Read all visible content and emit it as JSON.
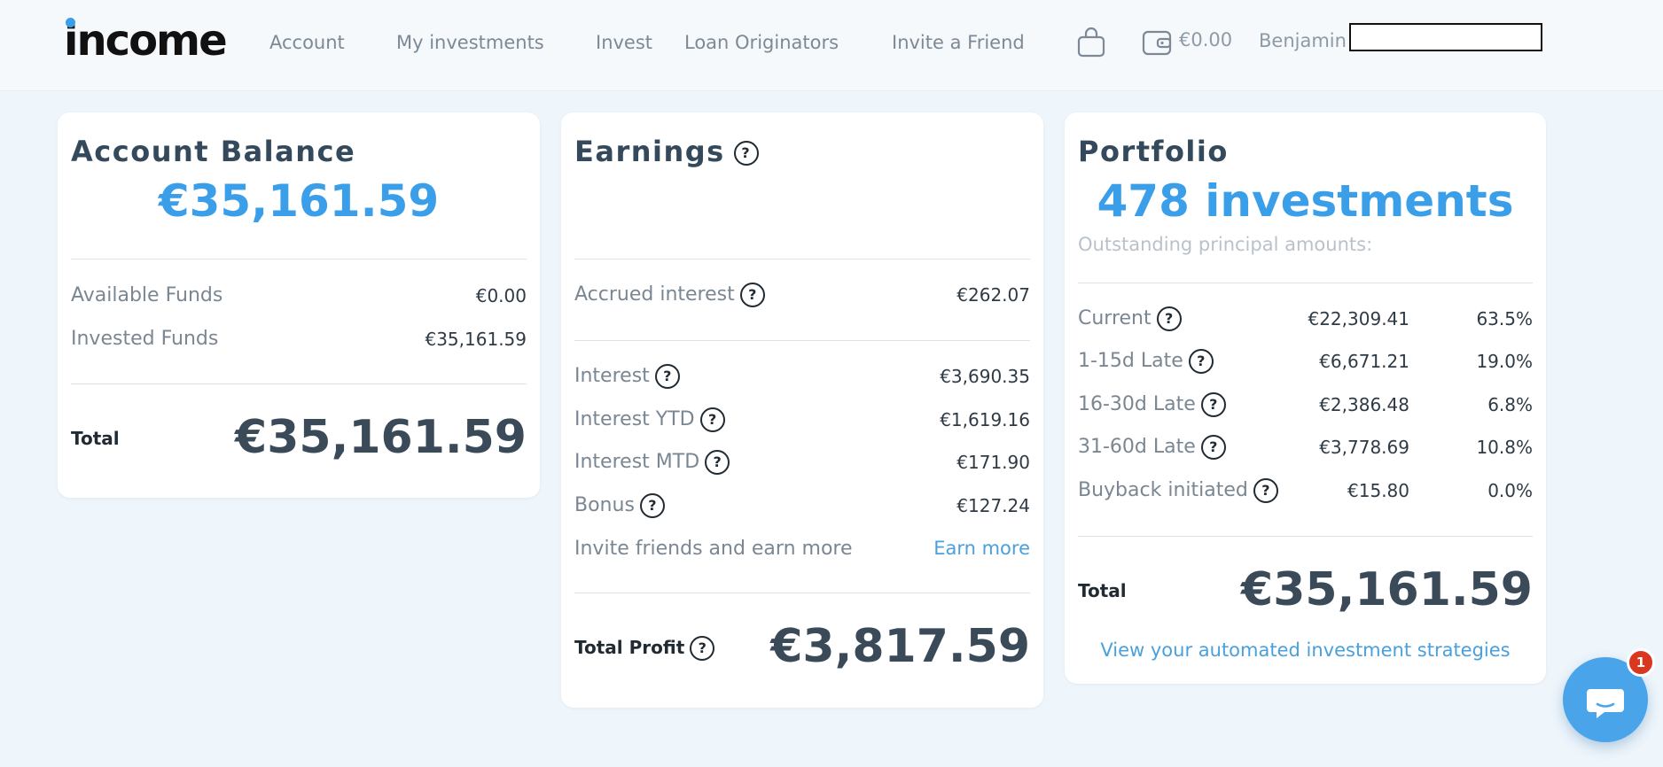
{
  "header": {
    "logo_text": "income",
    "nav": [
      "Account",
      "My investments",
      "Invest",
      "Loan Originators",
      "Invite a Friend"
    ],
    "wallet_amount": "€0.00",
    "user_name": "Benjamin"
  },
  "account_balance": {
    "title": "Account Balance",
    "balance": "€35,161.59",
    "rows": [
      {
        "label": "Available Funds",
        "value": "€0.00"
      },
      {
        "label": "Invested Funds",
        "value": "€35,161.59"
      }
    ],
    "total_label": "Total",
    "total_value": "€35,161.59"
  },
  "earnings": {
    "title": "Earnings",
    "accrued": {
      "label": "Accrued interest",
      "value": "€262.07"
    },
    "rows": [
      {
        "label": "Interest",
        "value": "€3,690.35"
      },
      {
        "label": "Interest YTD",
        "value": "€1,619.16"
      },
      {
        "label": "Interest MTD",
        "value": "€171.90"
      },
      {
        "label": "Bonus",
        "value": "€127.24"
      }
    ],
    "invite_label": "Invite friends and earn more",
    "invite_link": "Earn more",
    "total_label": "Total Profit",
    "total_value": "€3,817.59"
  },
  "portfolio": {
    "title": "Portfolio",
    "count": "478 investments",
    "subtitle": "Outstanding principal amounts:",
    "rows": [
      {
        "label": "Current",
        "value": "€22,309.41",
        "percent": "63.5%"
      },
      {
        "label": "1-15d Late",
        "value": "€6,671.21",
        "percent": "19.0%"
      },
      {
        "label": "16-30d Late",
        "value": "€2,386.48",
        "percent": "6.8%"
      },
      {
        "label": "31-60d Late",
        "value": "€3,778.69",
        "percent": "10.8%"
      },
      {
        "label": "Buyback initiated",
        "value": "€15.80",
        "percent": "0.0%"
      }
    ],
    "total_label": "Total",
    "total_value": "€35,161.59",
    "strategies_link": "View your automated investment strategies"
  },
  "help_glyph": "?",
  "chat": {
    "badge_count": "1"
  },
  "colors": {
    "accent": "#3a9ee8",
    "heading": "#34495c",
    "badge": "#d9371f"
  }
}
